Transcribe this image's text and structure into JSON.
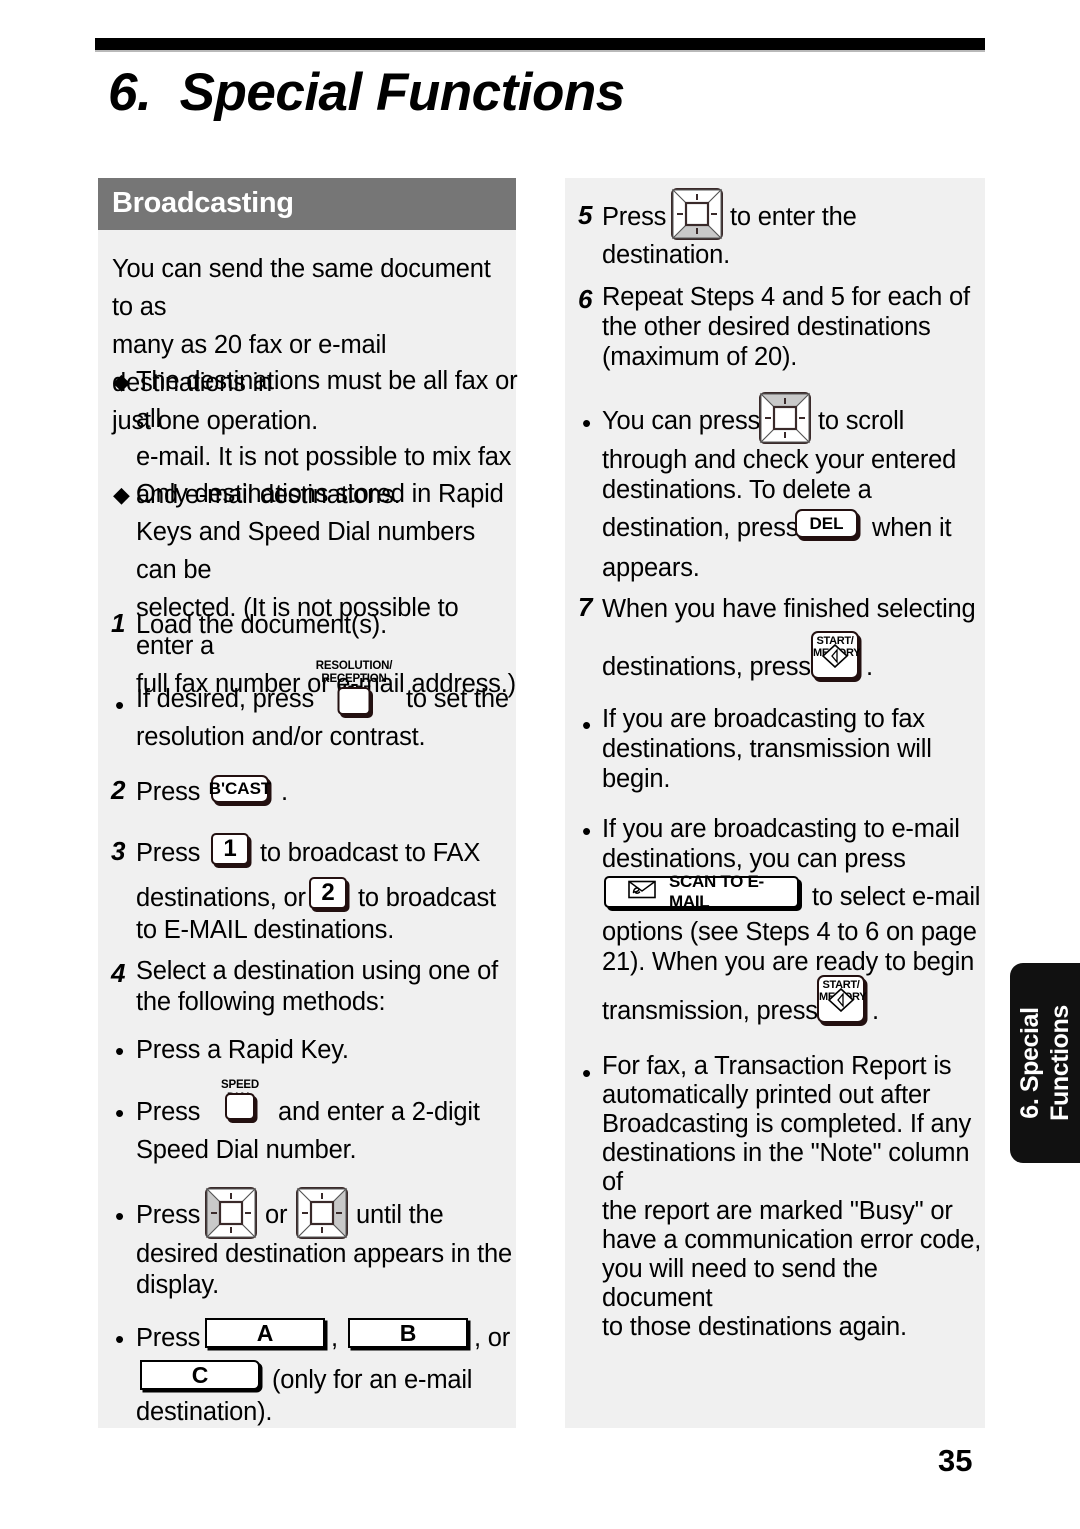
{
  "page": {
    "chapter_title": "6.  Special Functions",
    "page_number": "35",
    "side_tab_text": "6. Special\nFunctions"
  },
  "section": {
    "heading": "Broadcasting"
  },
  "left_column": {
    "intro": "You can send the same document to as\nmany as 20 fax or e-mail destinations in\njust one operation.",
    "notes": [
      "The destinations must be all fax or all\ne-mail. It is not possible to mix fax\nand e-mail destinations.",
      "Only destinations stored in Rapid\nKeys and Speed Dial numbers can be\nselected. (It is not possible to enter a\nfull fax number or e-mail address.)"
    ],
    "step1": {
      "number": "1",
      "text": "Load the document(s)."
    },
    "step1_bullet": {
      "before": "If desired, press",
      "after": "to set the",
      "line2": "resolution and/or contrast.",
      "key_caption": "RESOLUTION/\nRECEPTION MODE"
    },
    "step2": {
      "number": "2",
      "before": "Press",
      "key": "B'CAST",
      "after": "."
    },
    "step3": {
      "number": "3",
      "before": "Press",
      "key1": "1",
      "mid": "to broadcast to FAX",
      "line2_before": "destinations, or",
      "key2": "2",
      "line2_after": "to broadcast",
      "line3": "to E-MAIL destinations."
    },
    "step4": {
      "number": "4",
      "text": "Select a destination using one of\nthe following methods:"
    },
    "step4_bullets": {
      "b1": "Press a Rapid Key.",
      "b2_before": "Press",
      "b2_caption": "SPEED DIAL",
      "b2_after": "and enter a 2-digit",
      "b2_line2": "Speed Dial number.",
      "b3_before": "Press",
      "b3_or": "or",
      "b3_after": "until the",
      "b3_line2": "desired  destination appears in the",
      "b3_line3": "display.",
      "b4_before": "Press",
      "b4_keyA": "A",
      "b4_comma": ",",
      "b4_keyB": "B",
      "b4_or": ", or",
      "b4_keyC": "C",
      "b4_after": "(only for an e-mail",
      "b4_line2": "destination)."
    }
  },
  "right_column": {
    "step5": {
      "number": "5",
      "before": "Press",
      "after": "to enter the",
      "line2": "destination."
    },
    "step6": {
      "number": "6",
      "text": "Repeat Steps 4 and 5 for each of\nthe other desired destinations\n(maximum of 20)."
    },
    "step6_bullet": {
      "before": "You can press",
      "after": "to scroll",
      "line2": "through and check your entered",
      "line3": "destinations. To delete a",
      "line4_before": "destination, press",
      "del_key": "DEL",
      "line4_after": "when it",
      "line5": "appears."
    },
    "step7": {
      "number": "7",
      "text": "When you have finished selecting",
      "line2_before": "destinations, press",
      "line2_after": ".",
      "start_key_caption": "START/\nMEMORY"
    },
    "step7_bullets": {
      "b1": "If you are broadcasting to fax\ndestinations, transmission will\nbegin.",
      "b2_line1": "If you are broadcasting to e-mail",
      "b2_line2": "destinations, you can press",
      "b2_scan_key": "SCAN TO E-MAIL",
      "b2_line3_after": "to select e-mail",
      "b2_line4": "options (see Steps 4 to 6 on page",
      "b2_line5": "21). When you are ready to begin",
      "b2_line6_before": "transmission, press",
      "b2_line6_after": ".",
      "b3": "For fax, a Transaction Report is\nautomatically printed out after\nBroadcasting is completed. If any\ndestinations in the \"Note\" column of\nthe report are marked \"Busy\" or\nhave a communication error code,\nyou will need to send the document\nto those destinations again."
    }
  },
  "icons": {
    "diamond_bullet": "◆",
    "round_bullet": "•",
    "arrow_key": "arrow-rocker-key",
    "envelope": "envelope-e-icon",
    "start_diamond": "start-diamond-icon"
  },
  "colors": {
    "section_bar": "#767676",
    "panel_bg": "#f0f0f0",
    "side_tab": "#111111",
    "rule": "#000000"
  }
}
